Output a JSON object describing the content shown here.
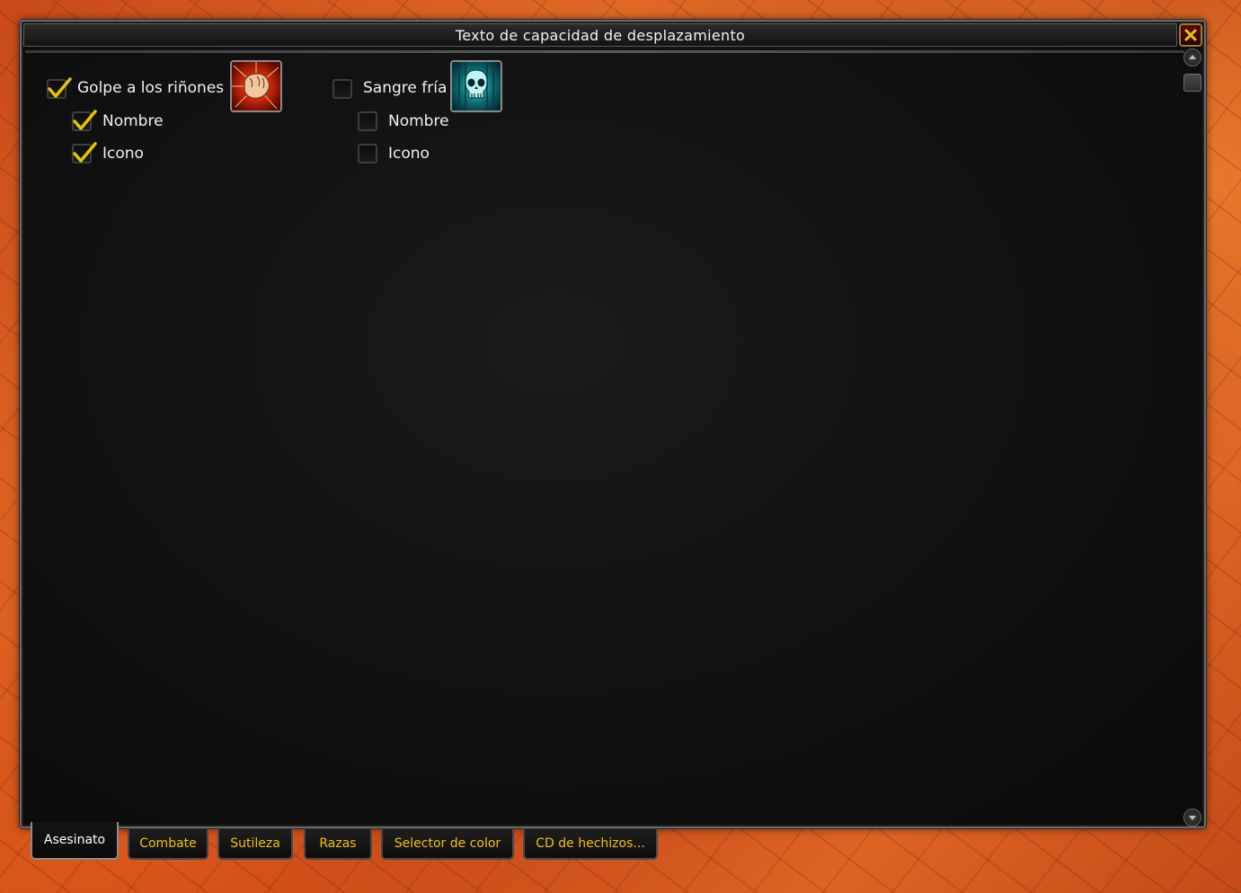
{
  "window": {
    "title": "Texto de capacidad de desplazamiento",
    "close_label": "Cerrar"
  },
  "spells": [
    {
      "label": "Golpe a los riñones",
      "checked": true,
      "icon": "kidney-shot-fist-icon",
      "options": [
        {
          "label": "Nombre",
          "checked": true
        },
        {
          "label": "Icono",
          "checked": true
        }
      ]
    },
    {
      "label": "Sangre fría",
      "checked": false,
      "icon": "cold-blood-skull-icon",
      "options": [
        {
          "label": "Nombre",
          "checked": false
        },
        {
          "label": "Icono",
          "checked": false
        }
      ]
    }
  ],
  "tabs": [
    {
      "label": "Asesinato",
      "active": true
    },
    {
      "label": "Combate",
      "active": false
    },
    {
      "label": "Sutileza",
      "active": false
    },
    {
      "label": "Razas",
      "active": false
    },
    {
      "label": "Selector de color",
      "active": false
    },
    {
      "label": "CD de hechizos...",
      "active": false
    }
  ],
  "colors": {
    "tab_text": "#f2c400",
    "check_mark": "#e8c400",
    "close_x": "#f2c400"
  }
}
